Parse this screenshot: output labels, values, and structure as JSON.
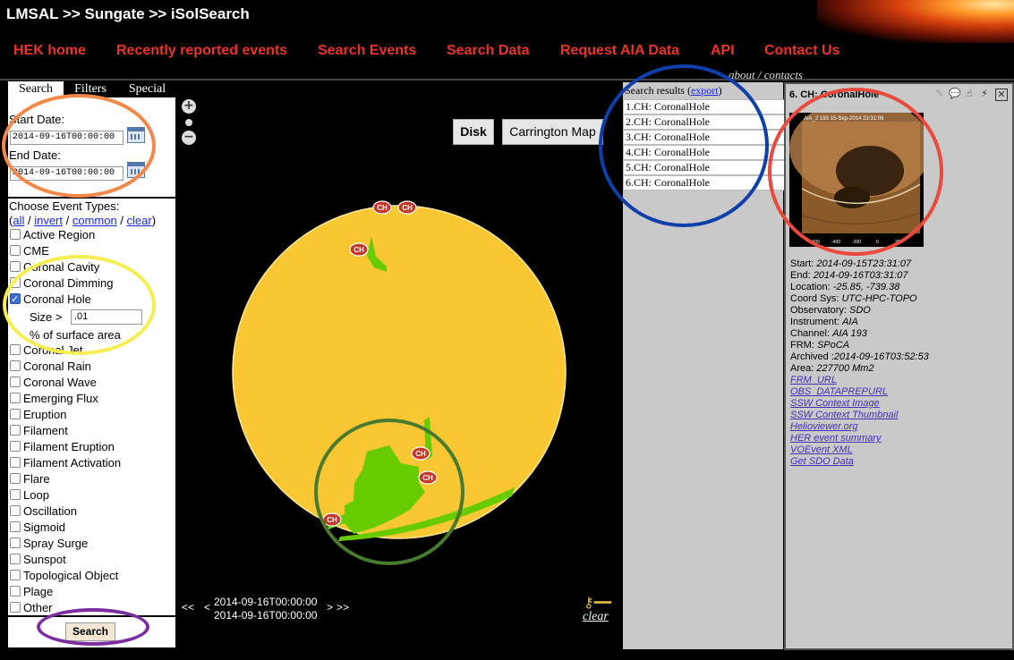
{
  "header": {
    "title": "LMSAL >> Sungate >> iSolSearch"
  },
  "nav": {
    "items": [
      "HEK home",
      "Recently reported events",
      "Search Events",
      "Search Data",
      "Request AIA Data",
      "API",
      "Contact Us"
    ]
  },
  "about": "about / contacts",
  "left": {
    "tabs": [
      "Search",
      "Filters",
      "Special"
    ],
    "start_label": "Start Date:",
    "start_value": "2014-09-16T00:00:00",
    "end_label": "End Date:",
    "end_value": "2014-09-16T00:00:00",
    "types_title": "Choose Event Types:",
    "types_links": {
      "all": "all",
      "invert": "invert",
      "common": "common",
      "clear": "clear"
    },
    "size_label": "Size >",
    "size_value": ".01",
    "size_unit": "% of surface area",
    "event_types": [
      "Active Region",
      "CME",
      "Coronal Cavity",
      "Coronal Dimming",
      "Coronal Hole",
      "Coronal Jet",
      "Coronal Rain",
      "Coronal Wave",
      "Emerging Flux",
      "Eruption",
      "Filament",
      "Filament Eruption",
      "Filament Activation",
      "Flare",
      "Loop",
      "Oscillation",
      "Sigmoid",
      "Spray Surge",
      "Sunspot",
      "Topological Object",
      "Plage",
      "Other"
    ],
    "checked": "Coronal Hole",
    "search_button": "Search"
  },
  "map": {
    "disk_button": "Disk",
    "carrington_button": "Carrington Map",
    "zoom_in": "+",
    "zoom_out": "−",
    "prev": "<<",
    "prev_single": "<",
    "time_start": "2014-09-16T00:00:00",
    "time_end": "2014-09-16T00:00:00",
    "next": ">>",
    "next_single": ">",
    "marker_label": "CH",
    "clear": "clear",
    "colors": {
      "disk": "#f8c732",
      "coronal_hole": "#66cc00",
      "marker": "#c0392b"
    }
  },
  "results": {
    "title": "Search results (",
    "export": "export",
    "close_paren": ")",
    "rows": [
      "1.CH: CoronalHole",
      "2.CH: CoronalHole",
      "3.CH: CoronalHole",
      "4.CH: CoronalHole",
      "5.CH: CoronalHole",
      "6.CH: CoronalHole"
    ]
  },
  "detail": {
    "title": "6. CH: CoronalHole",
    "fields": [
      {
        "label": "Start: ",
        "value": "2014-09-15T23:31:07"
      },
      {
        "label": "End: ",
        "value": "2014-09-16T03:31:07"
      },
      {
        "label": "Location: ",
        "value": "-25.85, -739.38"
      },
      {
        "label": "Coord Sys: ",
        "value": "UTC-HPC-TOPO"
      },
      {
        "label": "Observatory: ",
        "value": "SDO"
      },
      {
        "label": "Instrument: ",
        "value": "AIA"
      },
      {
        "label": "Channel: ",
        "value": "AIA 193"
      },
      {
        "label": "FRM: ",
        "value": "SPoCA"
      },
      {
        "label": "Archived :",
        "value": "2014-09-16T03:52:53"
      },
      {
        "label": "Area: ",
        "value": "227700 Mm2"
      }
    ],
    "links": [
      "FRM_URL",
      "OBS_DATAPREPURL",
      "SSW Context Image",
      "SSW Context Thumbnail",
      "Helioviewer.org",
      "HER event summary",
      "VOEvent XML",
      "Get SDO Data"
    ],
    "thumb_caption": "AIA_2 193 15-Sep-2014 23:31:06",
    "thumb_ticks": [
      "-600",
      "-400",
      "-200",
      "0",
      "200"
    ]
  },
  "annotation_colors": {
    "orange": "#f2884a",
    "yellow": "#f4ee52",
    "purple": "#7b2ea0",
    "green": "#4a7a2e",
    "blue": "#0f3fa8",
    "red": "#ea4a3d"
  }
}
